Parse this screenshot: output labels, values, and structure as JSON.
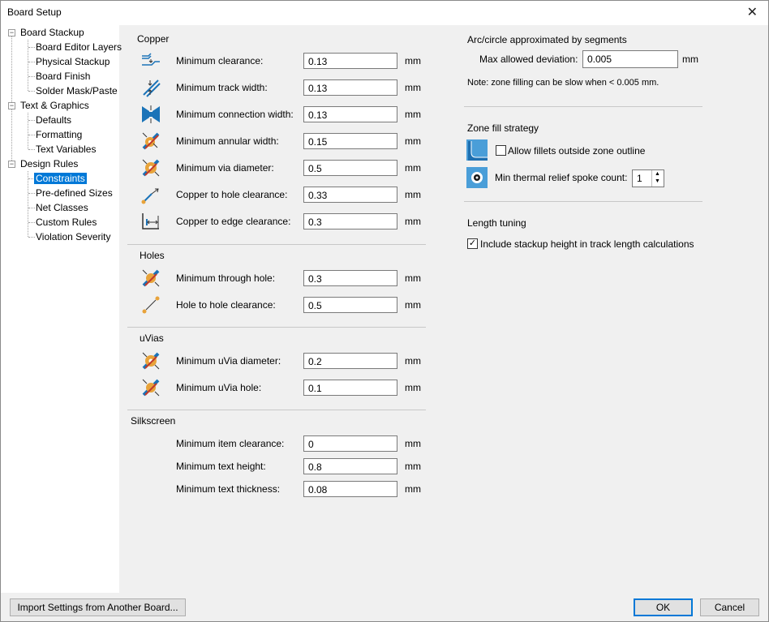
{
  "window": {
    "title": "Board Setup",
    "close_glyph": "✕"
  },
  "tree": {
    "groups": [
      {
        "label": "Board Stackup",
        "children": [
          "Board Editor Layers",
          "Physical Stackup",
          "Board Finish",
          "Solder Mask/Paste"
        ]
      },
      {
        "label": "Text & Graphics",
        "children": [
          "Defaults",
          "Formatting",
          "Text Variables"
        ]
      },
      {
        "label": "Design Rules",
        "children": [
          "Constraints",
          "Pre-defined Sizes",
          "Net Classes",
          "Custom Rules",
          "Violation Severity"
        ]
      }
    ],
    "selected": "Constraints",
    "expander_glyph": "−"
  },
  "copper": {
    "header": "Copper",
    "rows": [
      {
        "label": "Minimum clearance:",
        "value": "0.13",
        "unit": "mm",
        "icon": "clearance-icon"
      },
      {
        "label": "Minimum track width:",
        "value": "0.13",
        "unit": "mm",
        "icon": "track-width-icon"
      },
      {
        "label": "Minimum connection width:",
        "value": "0.13",
        "unit": "mm",
        "icon": "connection-width-icon"
      },
      {
        "label": "Minimum annular width:",
        "value": "0.15",
        "unit": "mm",
        "icon": "annular-width-icon"
      },
      {
        "label": "Minimum via diameter:",
        "value": "0.5",
        "unit": "mm",
        "icon": "via-diameter-icon"
      },
      {
        "label": "Copper to hole clearance:",
        "value": "0.33",
        "unit": "mm",
        "icon": "hole-clearance-icon"
      },
      {
        "label": "Copper to edge clearance:",
        "value": "0.3",
        "unit": "mm",
        "icon": "edge-clearance-icon"
      }
    ]
  },
  "holes": {
    "header": "Holes",
    "rows": [
      {
        "label": "Minimum through hole:",
        "value": "0.3",
        "unit": "mm",
        "icon": "through-hole-icon"
      },
      {
        "label": "Hole to hole clearance:",
        "value": "0.5",
        "unit": "mm",
        "icon": "hole-to-hole-icon"
      }
    ]
  },
  "uvias": {
    "header": "uVias",
    "rows": [
      {
        "label": "Minimum uVia diameter:",
        "value": "0.2",
        "unit": "mm",
        "icon": "uvia-diameter-icon"
      },
      {
        "label": "Minimum uVia hole:",
        "value": "0.1",
        "unit": "mm",
        "icon": "uvia-hole-icon"
      }
    ]
  },
  "silkscreen": {
    "header": "Silkscreen",
    "rows": [
      {
        "label": "Minimum item clearance:",
        "value": "0",
        "unit": "mm"
      },
      {
        "label": "Minimum text height:",
        "value": "0.8",
        "unit": "mm"
      },
      {
        "label": "Minimum text thickness:",
        "value": "0.08",
        "unit": "mm"
      }
    ]
  },
  "arc": {
    "header": "Arc/circle approximated by segments",
    "deviation_label": "Max allowed deviation:",
    "deviation_value": "0.005",
    "deviation_unit": "mm",
    "note": "Note: zone filling can be slow when < 0.005 mm."
  },
  "zone": {
    "header": "Zone fill strategy",
    "fillets_label": "Allow fillets outside zone outline",
    "fillets_checked": false,
    "spoke_label": "Min thermal relief spoke count:",
    "spoke_value": "1"
  },
  "length": {
    "header": "Length tuning",
    "stackup_label": "Include stackup height in track length calculations",
    "stackup_checked": true,
    "check_glyph": "✓"
  },
  "buttons": {
    "import": "Import Settings from Another Board...",
    "ok": "OK",
    "cancel": "Cancel"
  },
  "colors": {
    "selection": "#0078d7",
    "icon_blue": "#1a73b8",
    "icon_orange": "#e8a33a",
    "icon_red": "#c0392b"
  }
}
